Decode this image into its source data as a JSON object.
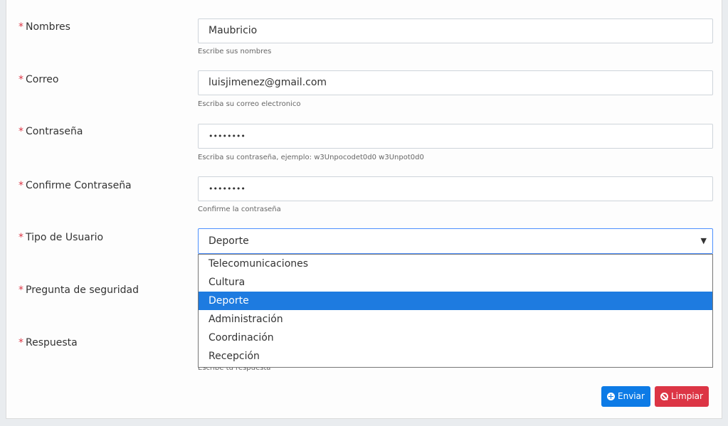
{
  "form": {
    "nombres": {
      "label": "Nombres",
      "value": "Maubricio",
      "help": "Escribe sus nombres"
    },
    "correo": {
      "label": "Correo",
      "value": "luisjimenez@gmail.com",
      "help": "Escriba su correo electronico"
    },
    "contrasena": {
      "label": "Contraseña",
      "value": "••••••••",
      "help": "Escriba su contraseña, ejemplo: w3Unpocodet0d0 w3Unpot0d0"
    },
    "confirmar": {
      "label": "Confirme Contraseña",
      "value": "••••••••",
      "help": "Confirme la contraseña"
    },
    "tipo_usuario": {
      "label": "Tipo de Usuario",
      "selected": "Deporte",
      "options": [
        "Telecomunicaciones",
        "Cultura",
        "Deporte",
        "Administración",
        "Coordinación",
        "Recepción"
      ]
    },
    "pregunta": {
      "label": "Pregunta de seguridad"
    },
    "respuesta": {
      "label": "Respuesta",
      "help": "Escribe tu respuesta"
    }
  },
  "buttons": {
    "send_label": "Enviar",
    "clear_label": "Limpiar"
  },
  "colors": {
    "required": "#dc3545",
    "primary": "#0d7be6",
    "danger": "#dc3545",
    "highlight": "#1e7be0"
  },
  "required_mark": "*"
}
